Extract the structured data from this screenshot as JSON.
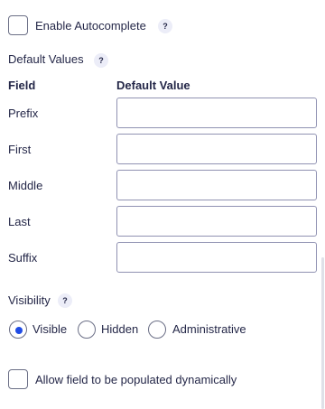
{
  "autocomplete": {
    "label": "Enable Autocomplete",
    "help": "?",
    "checked": false
  },
  "default_values": {
    "heading": "Default Values",
    "help": "?",
    "columns": [
      "Field",
      "Default Value"
    ],
    "rows": [
      {
        "field": "Prefix",
        "value": ""
      },
      {
        "field": "First",
        "value": ""
      },
      {
        "field": "Middle",
        "value": ""
      },
      {
        "field": "Last",
        "value": ""
      },
      {
        "field": "Suffix",
        "value": ""
      }
    ]
  },
  "visibility": {
    "heading": "Visibility",
    "help": "?",
    "options": [
      "Visible",
      "Hidden",
      "Administrative"
    ],
    "selected": "Visible"
  },
  "dynamic": {
    "label": "Allow field to be populated dynamically",
    "checked": false
  },
  "colors": {
    "text": "#242748",
    "accent": "#204ce5",
    "border": "#9092b2",
    "help_bg": "#ecedf8"
  }
}
